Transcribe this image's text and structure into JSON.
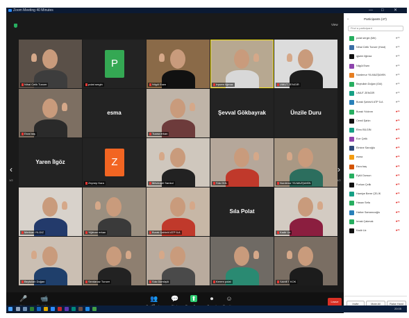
{
  "window": {
    "title": "Zoom Meeting 40 Minutes",
    "controls": [
      "—",
      "□",
      "✕"
    ]
  },
  "view_label": "View",
  "participants_panel": {
    "title": "Participants (47)",
    "search_placeholder": "Find a participant",
    "participants": [
      {
        "name": "polat sergin (Me)",
        "color": "#27ae60",
        "status": "on"
      },
      {
        "name": "Nihal Celik Tuncer (Host)",
        "color": "#3b6ea5",
        "status": "on"
      },
      {
        "name": "ıgsem ilğmaz",
        "color": "#111111",
        "status": "on"
      },
      {
        "name": "Nilgül Esen",
        "color": "#8e44ad",
        "status": "on"
      },
      {
        "name": "Nurdenur YILMAZŞAHİN",
        "color": "#e67e22",
        "status": "on"
      },
      {
        "name": "Beytullah Doğan (Gül)",
        "color": "#27ae60",
        "status": "on"
      },
      {
        "name": "UMUT ZENGİR",
        "color": "#16a085",
        "status": "on"
      },
      {
        "name": "Burak Şahin/4 ATP İLA",
        "color": "#2980b9",
        "status": "on"
      },
      {
        "name": "Burak Yıldırım",
        "color": "#27ae60",
        "status": "off"
      },
      {
        "name": "Cemil Şahin",
        "color": "#111111",
        "status": "off"
      },
      {
        "name": "Ebru   BİLGİN",
        "color": "#16a085",
        "status": "off"
      },
      {
        "name": "Ece Çelik",
        "color": "#8e44ad",
        "status": "off"
      },
      {
        "name": "Elmine Sarıoğlu",
        "color": "#2e4a7a",
        "status": "off"
      },
      {
        "name": "esma",
        "color": "#f39c12",
        "status": "off"
      },
      {
        "name": "Esra baş",
        "color": "#d35400",
        "status": "off"
      },
      {
        "name": "Eylül Dursun",
        "color": "#27ae60",
        "status": "off"
      },
      {
        "name": "Furkan Çelik",
        "color": "#111111",
        "status": "off"
      },
      {
        "name": "Hamiye Berre ÇELİK",
        "color": "#16a085",
        "status": "off"
      },
      {
        "name": "Hasan Sefa",
        "color": "#27ae60",
        "status": "off"
      },
      {
        "name": "Hatice Samancıoğlu",
        "color": "#2980b9",
        "status": "off"
      },
      {
        "name": "Irmak Çakmak",
        "color": "#27ae60",
        "status": "off"
      },
      {
        "name": "Kadir Uz",
        "color": "#111111",
        "status": "off"
      }
    ],
    "footer_buttons": [
      "Invite",
      "Mute All",
      "Raise Hand"
    ]
  },
  "tiles": [
    {
      "name": "Nihal Celik Tuncer",
      "type": "video",
      "bg": "#5a5048",
      "shirt": "#3d3d3d"
    },
    {
      "name": "polat sergin",
      "type": "avatar",
      "letter": "P",
      "avatar_color": "#34a853",
      "bg": "#232323"
    },
    {
      "name": "Nilgül Esen",
      "type": "video",
      "bg": "#8a6a48",
      "shirt": "#111111"
    },
    {
      "name": "Irşsem ilğmaz",
      "type": "video",
      "bg": "#b7a891",
      "shirt": "#d8d8d8",
      "speaking": true
    },
    {
      "name": "UMUT ZENGİR",
      "type": "video",
      "bg": "#dcdcdc",
      "shirt": "#1d1d1d"
    },
    {
      "name": "Esra baş",
      "type": "video",
      "bg": "#7d6f62",
      "shirt": "#2a2a2a"
    },
    {
      "name": "",
      "type": "name",
      "label": "esma"
    },
    {
      "name": "Tuana erkan",
      "type": "video",
      "bg": "#bfb4a8",
      "shirt": "#6d3b3b"
    },
    {
      "name": "",
      "type": "name",
      "label": "Şevval Gökbayrak"
    },
    {
      "name": "",
      "type": "name",
      "label": "Ünzile Duru"
    },
    {
      "name": "",
      "type": "name",
      "label": "Yaren İlgöz"
    },
    {
      "name": "Zeynep Kara",
      "type": "avatar",
      "letter": "Z",
      "avatar_color": "#f26522",
      "bg": "#232323"
    },
    {
      "name": "Mevzugül Sarıkol",
      "type": "video",
      "bg": "#cfc7bd",
      "shirt": "#222222"
    },
    {
      "name": "Sıla GÜL",
      "type": "video",
      "bg": "#b5a79a",
      "shirt": "#c0392b"
    },
    {
      "name": "Nurdenur YILMAZŞAHİN",
      "type": "video",
      "bg": "#a99884",
      "shirt": "#2c6e5e"
    },
    {
      "name": "Mertcan YILDIZ",
      "type": "video",
      "bg": "#d8d2cb",
      "shirt": "#233a6b"
    },
    {
      "name": "Yiğitcan erkan",
      "type": "video",
      "bg": "#9b8f80",
      "shirt": "#3a3a3a"
    },
    {
      "name": "Burak Şahin/4 ATP İLA",
      "type": "video",
      "bg": "#c7b7a6",
      "shirt": "#c0392b"
    },
    {
      "name": "",
      "type": "name",
      "label": "Sıla Polat"
    },
    {
      "name": "Kadir Uz",
      "type": "video",
      "bg": "#d3cbc2",
      "shirt": "#8b1e3f"
    },
    {
      "name": "Beytullah Doğan",
      "type": "video",
      "bg": "#cbbfb3",
      "shirt": "#1f3f6b"
    },
    {
      "name": "Sevdanaz Tuncer",
      "type": "video",
      "bg": "#8e7f70",
      "shirt": "#222222"
    },
    {
      "name": "Sıla Gümüşlü",
      "type": "video",
      "bg": "#b9ab9e",
      "shirt": "#4a4a4a"
    },
    {
      "name": "Kerem polat",
      "type": "video",
      "bg": "#6f6a64",
      "shirt": "#2a8a72"
    },
    {
      "name": "SAMET KOK",
      "type": "video",
      "bg": "#7a6e63",
      "shirt": "#1c1c1c"
    }
  ],
  "nav": {
    "left": "‹",
    "right": "›",
    "left_page": "1/2",
    "right_page": "1/2"
  },
  "toolbar": {
    "items": [
      {
        "label": "Mute",
        "icon": "🎤"
      },
      {
        "label": "Start Video",
        "icon": "📹"
      },
      {
        "label": "Participants",
        "icon": "👥",
        "count": "47"
      },
      {
        "label": "Chat",
        "icon": "💬"
      },
      {
        "label": "Share Screen",
        "icon": "⬆"
      },
      {
        "label": "Record",
        "icon": "⏺"
      },
      {
        "label": "Reactions",
        "icon": "☺"
      }
    ],
    "leave": "Leave"
  },
  "taskbar": {
    "clock": "20:05"
  }
}
